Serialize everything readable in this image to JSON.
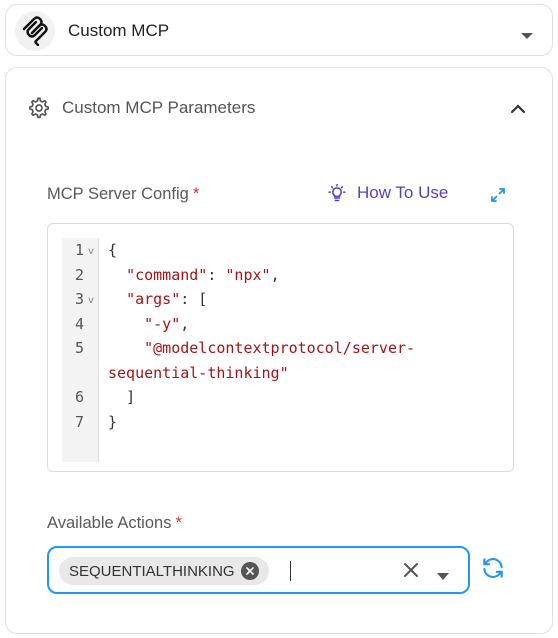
{
  "selector": {
    "title": "Custom MCP"
  },
  "panel": {
    "title": "Custom MCP Parameters",
    "config_label": "MCP Server Config",
    "required_mark": "*",
    "how_to_use": "How To Use",
    "code_lines": [
      {
        "num": "1",
        "fold": "v"
      },
      {
        "num": "2",
        "fold": ""
      },
      {
        "num": "3",
        "fold": "v"
      },
      {
        "num": "4",
        "fold": ""
      },
      {
        "num": "5",
        "fold": ""
      },
      {
        "num": "",
        "fold": ""
      },
      {
        "num": "6",
        "fold": ""
      },
      {
        "num": "7",
        "fold": ""
      }
    ],
    "code": {
      "l1": "{",
      "l2_key": "\"command\"",
      "l2_sep": ": ",
      "l2_val": "\"npx\"",
      "l2_end": ",",
      "l3_key": "\"args\"",
      "l3_sep": ": [",
      "l4_val": "\"-y\"",
      "l4_end": ",",
      "l5_val": "\"@modelcontextprotocol/server-",
      "l5b_val": "sequential-thinking\"",
      "l6": "]",
      "l7": "}"
    },
    "actions_label": "Available Actions",
    "actions": {
      "chips": [
        "SEQUENTIALTHINKING"
      ]
    }
  }
}
